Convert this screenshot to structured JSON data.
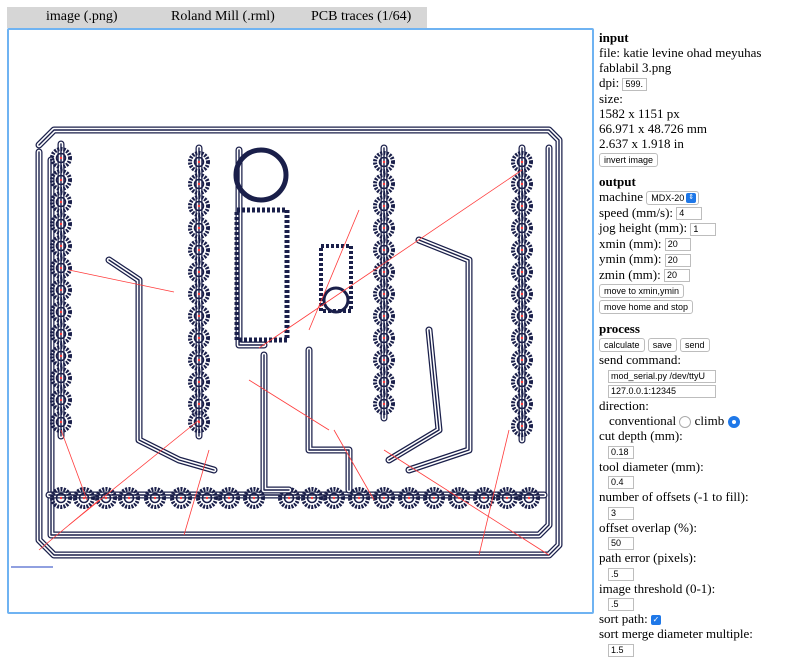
{
  "tabs": [
    "image (.png)",
    "Roland Mill (.rml)",
    "PCB traces (1/64)"
  ],
  "input": {
    "title": "input",
    "file_label": "file:",
    "file_name_1": "katie levine ohad meyuhas",
    "file_name_2": "fablabil 3.png",
    "dpi_label": "dpi:",
    "dpi_value": "599.",
    "size_label": "size:",
    "size_px": "1582 x 1151 px",
    "size_mm": "66.971 x 48.726 mm",
    "size_in": "2.637 x 1.918 in",
    "invert_button": "invert image"
  },
  "output": {
    "title": "output",
    "machine_label": "machine",
    "machine_value": "MDX-20",
    "speed_label": "speed (mm/s):",
    "speed_value": "4",
    "jog_label": "jog height (mm):",
    "jog_value": "1",
    "xmin_label": "xmin (mm):",
    "xmin_value": "20",
    "ymin_label": "ymin (mm):",
    "ymin_value": "20",
    "zmin_label": "zmin (mm):",
    "zmin_value": "20",
    "move_xy_button": "move to xmin,ymin",
    "home_button": "move home and stop"
  },
  "process": {
    "title": "process",
    "calculate_button": "calculate",
    "save_button": "save",
    "send_button": "send",
    "send_command_label": "send command:",
    "send_command_value": "mod_serial.py /dev/ttyU",
    "server_value": "127.0.0.1:12345",
    "direction_label": "direction:",
    "conventional_label": "conventional",
    "climb_label": "climb",
    "cut_depth_label": "cut depth (mm):",
    "cut_depth_value": "0.18",
    "tool_diameter_label": "tool diameter (mm):",
    "tool_diameter_value": "0.4",
    "offsets_label": "number of offsets (-1 to fill):",
    "offsets_value": "3",
    "overlap_label": "offset overlap (%):",
    "overlap_value": "50",
    "path_error_label": "path error (pixels):",
    "path_error_value": ".5",
    "threshold_label": "image threshold (0-1):",
    "threshold_value": ".5",
    "sort_label": "sort path:",
    "sort_merge_label": "sort merge diameter multiple:",
    "sort_merge_value": "1.5"
  },
  "colors": {
    "toolpath": "#1a1f4a",
    "travel": "#ff3b3b",
    "canvas_border": "#6fb3f2",
    "accent": "#1f78e8"
  }
}
